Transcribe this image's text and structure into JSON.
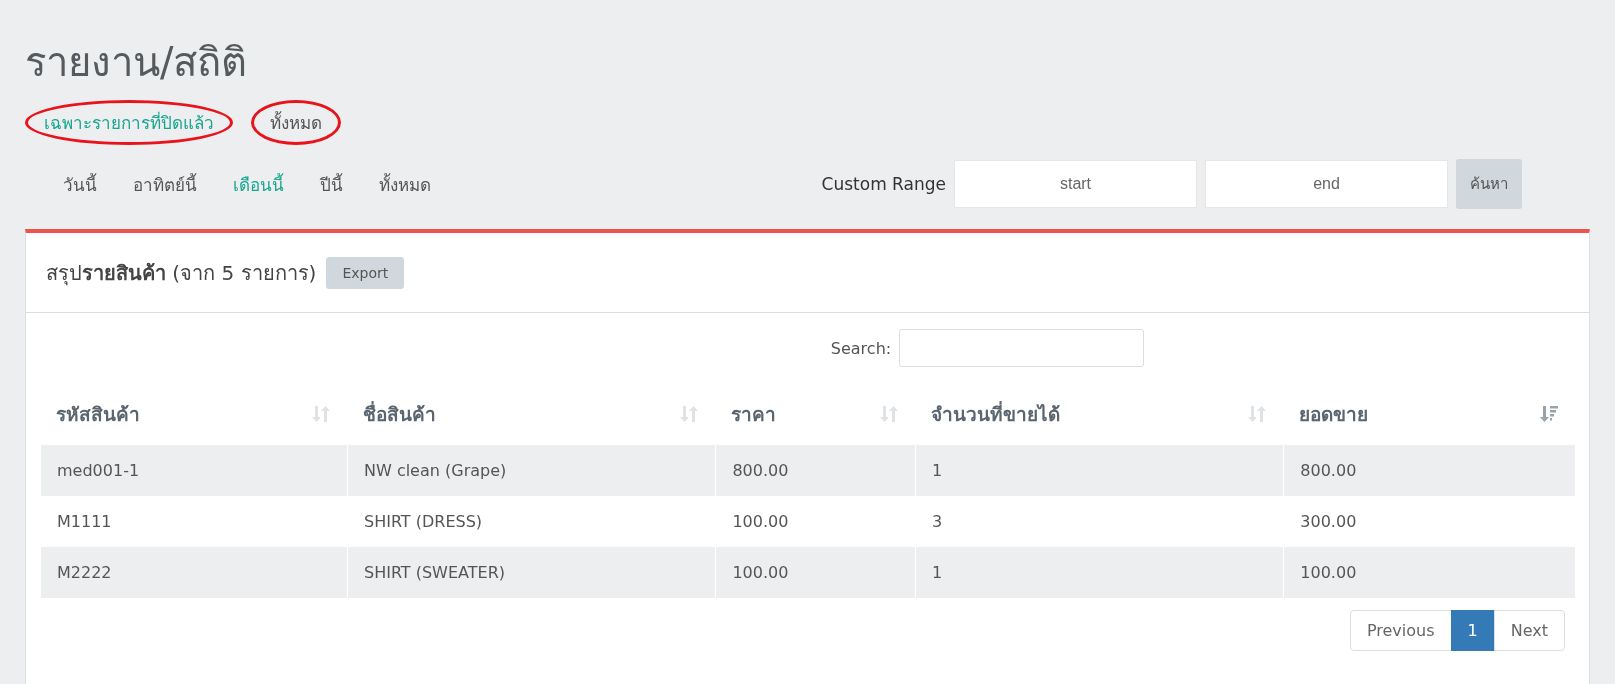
{
  "page_title": "รายงาน/สถิติ",
  "filter_links": [
    {
      "label": "เฉพาะรายการที่ปิดแล้ว",
      "selected": true,
      "circled": true
    },
    {
      "label": "ทั้งหมด",
      "selected": false,
      "circled": true
    }
  ],
  "period_tabs": [
    {
      "label": "วันนี้",
      "selected": false
    },
    {
      "label": "อาทิตย์นี้",
      "selected": false
    },
    {
      "label": "เดือนนี้",
      "selected": true
    },
    {
      "label": "ปีนี้",
      "selected": false
    },
    {
      "label": "ทั้งหมด",
      "selected": false
    }
  ],
  "custom_range": {
    "label": "Custom Range",
    "start": {
      "placeholder": "start"
    },
    "end": {
      "placeholder": "end"
    },
    "button": "ค้นหา"
  },
  "panel": {
    "title": "สรุป**รายสินค้า** (จาก 5 รายการ)",
    "export_button": "Export",
    "search_label": "Search:",
    "columns": [
      {
        "label": "รหัสสินค้า",
        "sorted": false
      },
      {
        "label": "ชื่อสินค้า",
        "sorted": false
      },
      {
        "label": "ราคา",
        "sorted": false
      },
      {
        "label": "จำนวนที่ขายได้",
        "sorted": false
      },
      {
        "label": "ยอดขาย",
        "sorted": true
      }
    ],
    "rows": [
      [
        "med001-1",
        "NW clean (Grape)",
        "800.00",
        "1",
        "800.00"
      ],
      [
        "M1111",
        "SHIRT (DRESS)",
        "100.00",
        "3",
        "300.00"
      ],
      [
        "M2222",
        "SHIRT (SWEATER)",
        "100.00",
        "1",
        "100.00"
      ]
    ],
    "pagination": [
      {
        "label": "Previous",
        "selected": false
      },
      {
        "label": "1",
        "selected": true
      },
      {
        "label": "Next",
        "selected": false
      }
    ]
  }
}
